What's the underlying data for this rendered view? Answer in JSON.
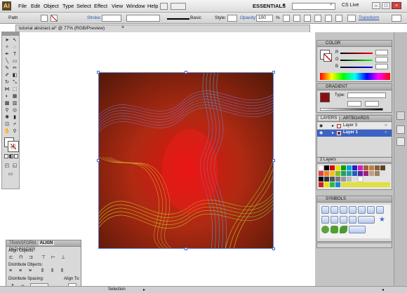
{
  "menubar": {
    "logo": "Ai",
    "items": [
      "File",
      "Edit",
      "Object",
      "Type",
      "Select",
      "Effect",
      "View",
      "Window",
      "Help"
    ],
    "workspace": "ESSENTIALS",
    "cslive": "CS Live"
  },
  "control": {
    "selection_type": "Path",
    "stroke_label": "Stroke:",
    "stroke_style": "Basic",
    "style_label": "Style:",
    "opacity_label": "Opacity:",
    "opacity_value": "100",
    "opacity_unit": "%",
    "transform_link": "Transform"
  },
  "document": {
    "tab_title": "tutorial abstract.ai* @ 77% (RGB/Preview)"
  },
  "panels": {
    "color": {
      "title": "COLOR",
      "letters": [
        "R",
        "G",
        "B"
      ]
    },
    "gradient": {
      "title": "GRADIENT",
      "type_label": "Type:"
    },
    "layers": {
      "tabs": [
        "LAYERS",
        "ARTBOARDS"
      ],
      "rows": [
        {
          "name": "Layer 3",
          "selected": false
        },
        {
          "name": "Layer 1",
          "selected": true
        }
      ],
      "count": "2 Layers"
    },
    "symbols": {
      "title": "SYMBOLS"
    },
    "transform": {
      "tabs": [
        "TRANSFORM",
        "ALIGN",
        "PATHFINDER"
      ],
      "align_objects": "Align Objects:",
      "distribute_objects": "Distribute Objects:",
      "distribute_spacing": "Distribute Spacing:",
      "align_to": "Align To:"
    }
  },
  "status": {
    "tool": "Selection"
  },
  "colors": {
    "accent_blue": "#3b6ed0",
    "layer_selected": "#3b63c4"
  }
}
